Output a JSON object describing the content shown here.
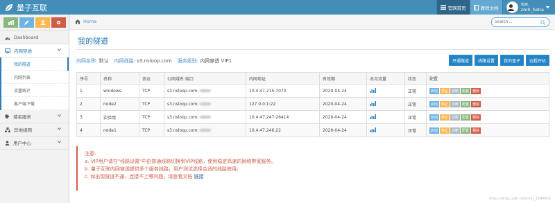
{
  "brand": {
    "name": "量子互联"
  },
  "topnav": {
    "official": "官网首页",
    "docs": "教程文档",
    "welcome": "欢迎,",
    "username": "zmh_haha"
  },
  "sidebar": {
    "items": [
      {
        "label": "Dashboard"
      },
      {
        "label": "内网穿透",
        "open": true
      },
      {
        "label": "域名服务"
      },
      {
        "label": "异地组网"
      },
      {
        "label": "用户中心"
      }
    ],
    "submenu": [
      "我的隧道",
      "内网列表",
      "流量统计",
      "客户端下载"
    ]
  },
  "breadcrumb": {
    "home": "Home"
  },
  "search": {
    "placeholder": "Search ..."
  },
  "page": {
    "title": "我的隧道"
  },
  "info": {
    "name_label": "内网名称:",
    "name_value": "默认",
    "route_label": "内网线路:",
    "route_value": "s3.nsloop.com",
    "level_label": "服务级别:",
    "level_value": "内网穿透 VIP1"
  },
  "actions": [
    "开通隧道",
    "线路设置",
    "我的盒子",
    "远程开机"
  ],
  "table": {
    "headers": [
      "序号",
      "名称",
      "协议",
      "公网域名:端口",
      "内网地址",
      "有效期",
      "本月流量",
      "状态",
      "配置"
    ],
    "rows": [
      {
        "no": "1",
        "name": "windows",
        "proto": "TCP",
        "domain": "s3.nsloop.com:",
        "local": "10.4.47.215:7070",
        "expire": "2020-04-24",
        "status": "正常"
      },
      {
        "no": "2",
        "name": "node2",
        "proto": "TCP",
        "domain": "s3.nsloop.com:",
        "local": "127.0.0.1:22",
        "expire": "2020-04-24",
        "status": "正常"
      },
      {
        "no": "3",
        "name": "实验用",
        "proto": "TCP",
        "domain": "s3.nsloop.com:",
        "local": "10.4.47.247:26414",
        "expire": "2020-04-24",
        "status": "正常"
      },
      {
        "no": "4",
        "name": "node1",
        "proto": "TCP",
        "domain": "s3.nsloop.com:",
        "local": "10.4.47.246:22",
        "expire": "2020-04-24",
        "status": "正常"
      }
    ],
    "config_buttons": [
      "启动",
      "停止",
      "诊断",
      "配置",
      "删除"
    ]
  },
  "notice": {
    "title": "注意:",
    "line_a": "a. VIP用户请在\"线路设置\"中由普通线路切换到VIP线路，使用稳定高速的网络带宽服务。",
    "line_b": "b. 量子互联内网穿透提供多个服务线路，用户测试选择合适的线路使用。",
    "line_c": "c. 如出现隧道不通、连接不上等问题，请查看文档",
    "link": "链接"
  },
  "watermark": "https://blog.csdn.net/zmh_1846665",
  "colors": {
    "header": "#438eb9",
    "accent": "#2283c5",
    "danger": "#d15b47"
  }
}
